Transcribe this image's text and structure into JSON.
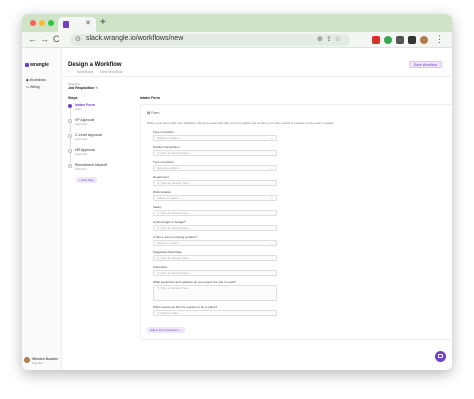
{
  "browser": {
    "new_tab_label": "+",
    "url": "slack.wrangle.io/workflows/new",
    "nav": {
      "back": "←",
      "forward": "→",
      "reload": "C"
    }
  },
  "sidebar": {
    "brand": "wrangle",
    "items": [
      {
        "label": "Workflows",
        "icon": "workflow-icon"
      },
      {
        "label": "Billing",
        "icon": "billing-icon"
      }
    ],
    "user": {
      "name": "Winston Bowden",
      "sub": "Log Out"
    }
  },
  "header": {
    "title": "Design a Workflow",
    "breadcrumbs": [
      "Workflows",
      "New Workflow"
    ],
    "save_label": "Save Workflow"
  },
  "workflow": {
    "label": "Workflow",
    "name": "Job Requisition"
  },
  "steps": {
    "heading": "Steps",
    "items": [
      {
        "title": "Intake Form",
        "sub": "Form",
        "active": true
      },
      {
        "title": "VP Approval",
        "sub": "Approval",
        "active": false
      },
      {
        "title": "C-Level Approval",
        "sub": "Approval",
        "active": false
      },
      {
        "title": "HR Approval",
        "sub": "Approval",
        "active": false
      },
      {
        "title": "Recruitment Handoff",
        "sub": "Task list",
        "active": false
      }
    ],
    "add_label": "Add Step"
  },
  "form": {
    "heading": "Intake Form",
    "type": "Form",
    "description": "When your users start your workflow, they'll be presented with a form to gather the content your team needs to execute on the user's request.",
    "questions": [
      {
        "label": "Type of position",
        "placeholder": "Select an option...",
        "kind": "select"
      },
      {
        "label": "Position Description",
        "placeholder": "Type an answer here...",
        "kind": "text"
      },
      {
        "label": "Type of position",
        "placeholder": "Select an option...",
        "kind": "select"
      },
      {
        "label": "Department",
        "placeholder": "Type an answer here...",
        "kind": "text"
      },
      {
        "label": "Work location",
        "placeholder": "Select an option...",
        "kind": "select"
      },
      {
        "label": "Salary",
        "placeholder": "Type an answer here...",
        "kind": "text"
      },
      {
        "label": "Is this budget in budget?",
        "placeholder": "Type an answer here...",
        "kind": "text"
      },
      {
        "label": "Is this a new or existing position?",
        "placeholder": "Select an option...",
        "kind": "select"
      },
      {
        "label": "Suggested Start Date",
        "placeholder": "Type an answer here...",
        "kind": "text"
      },
      {
        "label": "Supervisor",
        "placeholder": "Type an answer here...",
        "kind": "text"
      },
      {
        "label": "What equipment and software do you expect the role to need?",
        "placeholder": "Type an answer here...",
        "kind": "textarea"
      },
      {
        "label": "When would you like the position to be in place?",
        "placeholder": "Select a date...",
        "kind": "text"
      }
    ],
    "add_question_label": "Add a Form Question"
  }
}
